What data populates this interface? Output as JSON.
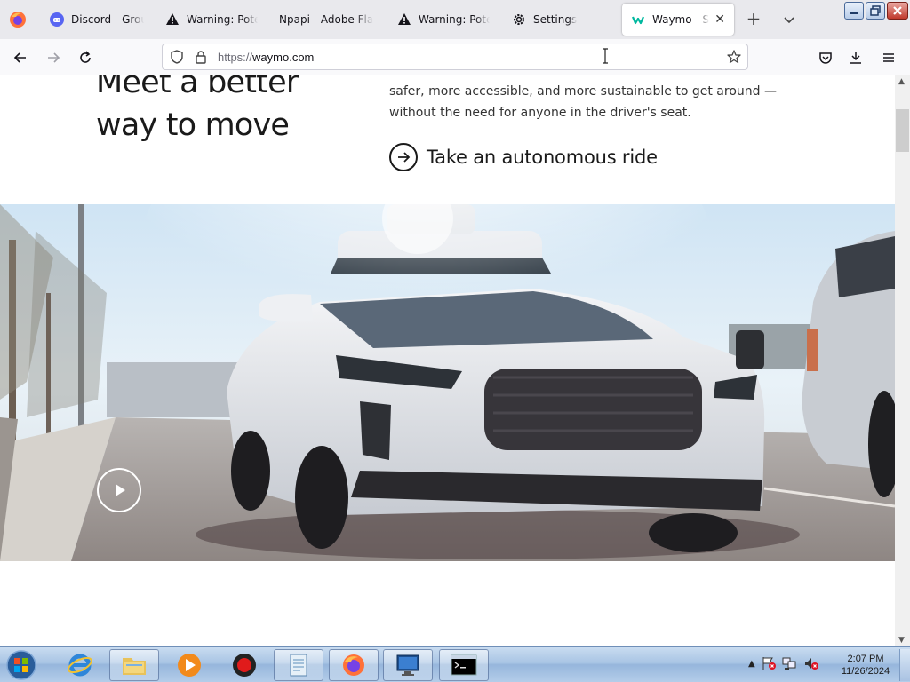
{
  "browser": {
    "tabs": [
      {
        "label": "Discord - Group",
        "icon": "discord-icon",
        "active": false
      },
      {
        "label": "Warning: Potential",
        "icon": "warning-icon",
        "active": false
      },
      {
        "label": "Npapi - Adobe Flash",
        "icon": "none",
        "active": false
      },
      {
        "label": "Warning: Potential",
        "icon": "warning-icon",
        "active": false
      },
      {
        "label": "Settings",
        "icon": "gear-icon",
        "active": false
      },
      {
        "label": "Waymo - Self",
        "icon": "waymo-icon",
        "active": true
      }
    ],
    "url_protocol": "https://",
    "url_host": "waymo.com"
  },
  "page": {
    "headline_line1": "Meet a better",
    "headline_line2": "way to move",
    "body_line1": "safer, more accessible, and more sustainable to get around —",
    "body_line2": "without the need for anyone in the driver's seat.",
    "cta_label": "Take an autonomous ride"
  },
  "taskbar": {
    "clock_time": "2:07 PM",
    "clock_date": "11/26/2024"
  },
  "colors": {
    "waymo_accent": "#00b89f",
    "text_dark": "#1a1a1a"
  }
}
